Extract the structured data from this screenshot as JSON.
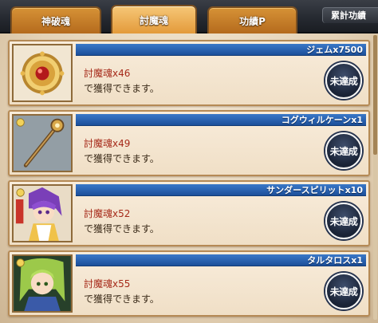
{
  "tabs": [
    {
      "label": "神破魂"
    },
    {
      "label": "討魔魂"
    },
    {
      "label": "功績P"
    }
  ],
  "side_label": "累計功績",
  "missions": [
    {
      "reward": "ジェムx7500",
      "requirement": "討魔魂x46",
      "description": "で獲得できます。",
      "status": "未達成",
      "icon": "gem-medal-icon"
    },
    {
      "reward": "コグウィルケーンx1",
      "requirement": "討魔魂x49",
      "description": "で獲得できます。",
      "status": "未達成",
      "icon": "cane-weapon-icon"
    },
    {
      "reward": "サンダースピリットx10",
      "requirement": "討魔魂x52",
      "description": "で獲得できます。",
      "status": "未達成",
      "icon": "thunder-spirit-character-icon"
    },
    {
      "reward": "タルタロスx1",
      "requirement": "討魔魂x55",
      "description": "で獲得できます。",
      "status": "未達成",
      "icon": "tartarus-character-icon"
    }
  ],
  "colors": {
    "tab": "#d69236",
    "tab_active": "#f6c777",
    "header_bar": "#2a63b3",
    "requirement_text": "#a62a1a",
    "status_badge": "#1a2336"
  }
}
